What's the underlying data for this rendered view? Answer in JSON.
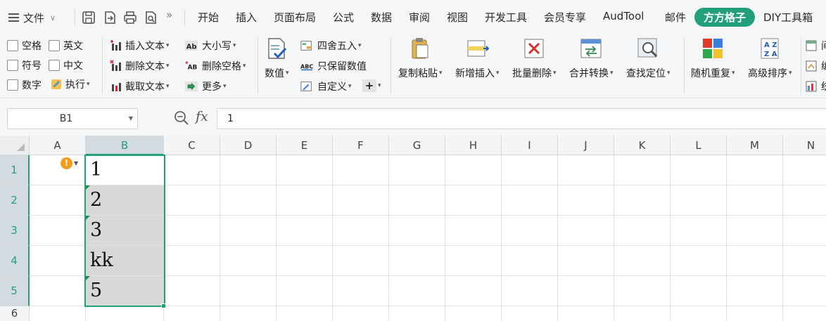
{
  "menubar": {
    "file_label": "文件",
    "more_quick": "»",
    "items": [
      "开始",
      "插入",
      "页面布局",
      "公式",
      "数据",
      "审阅",
      "视图",
      "开发工具",
      "会员专享",
      "AudTool",
      "邮件",
      "方方格子",
      "DIY工具箱"
    ],
    "active_item": "方方格子"
  },
  "ribbon": {
    "checkboxes": [
      "空格",
      "英文",
      "符号",
      "中文",
      "数字"
    ],
    "execute": "执行",
    "text_ops": [
      "插入文本",
      "删除文本",
      "截取文本"
    ],
    "case_ops": [
      "大小写",
      "删除空格",
      "更多"
    ],
    "numeric": "数值",
    "round_ops": [
      "四舍五入",
      "只保留数值",
      "自定义"
    ],
    "plus": "+",
    "big_buttons": [
      "复制粘贴",
      "新增插入",
      "批量删除",
      "合并转换",
      "查找定位",
      "随机重复",
      "高级排序"
    ],
    "right_partial": [
      "间",
      "编",
      "统"
    ]
  },
  "formula_bar": {
    "name_box": "B1",
    "fx": "fx",
    "value": "1"
  },
  "grid": {
    "columns": [
      "A",
      "B",
      "C",
      "D",
      "E",
      "F",
      "G",
      "H",
      "I",
      "J",
      "K",
      "L",
      "M",
      "N"
    ],
    "selected_column": "B",
    "rows": [
      "1",
      "2",
      "3",
      "4",
      "5",
      "6"
    ],
    "cells_B": [
      "1",
      "2",
      "3",
      "kk",
      "5"
    ],
    "warning_mark": "!"
  },
  "colors": {
    "accent": "#21a07a",
    "selection_fill": "#d8d8d8",
    "warning": "#f29b1c"
  }
}
